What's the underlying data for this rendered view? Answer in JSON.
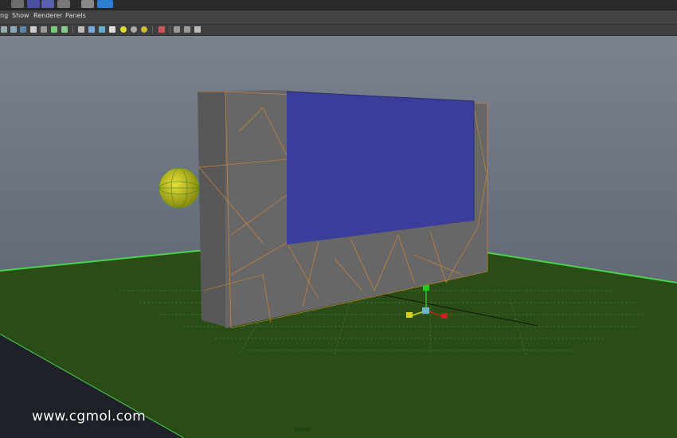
{
  "menubar": {
    "items": [
      "ng",
      "Show",
      "Renderer",
      "Panels"
    ]
  },
  "toolbar": {
    "icons": [
      "wireframe-icon",
      "smooth-shade-icon",
      "textured-icon",
      "lighting-icon",
      "shadows-icon",
      "isolate-icon",
      "xray-icon",
      "cube-icon",
      "shaded-cube-icon",
      "textured-cube-icon",
      "checker-icon",
      "sun-icon",
      "sphere-icon",
      "gold-sphere-icon",
      "select-icon",
      "frame-icon",
      "network-icon"
    ]
  },
  "viewport": {
    "camera_label": "persp",
    "colors": {
      "sky_top": "#7a8290",
      "sky_bottom": "#5c6573",
      "ground": "#2a4d17",
      "ground_edge": "#4cd14c",
      "wall_face": "#676767",
      "wall_side": "#585858",
      "screen": "#3a3d9a",
      "wire": "#e08a2a",
      "sphere": "#c8c21a"
    }
  },
  "watermark": {
    "text": "www.cgmol.com"
  }
}
